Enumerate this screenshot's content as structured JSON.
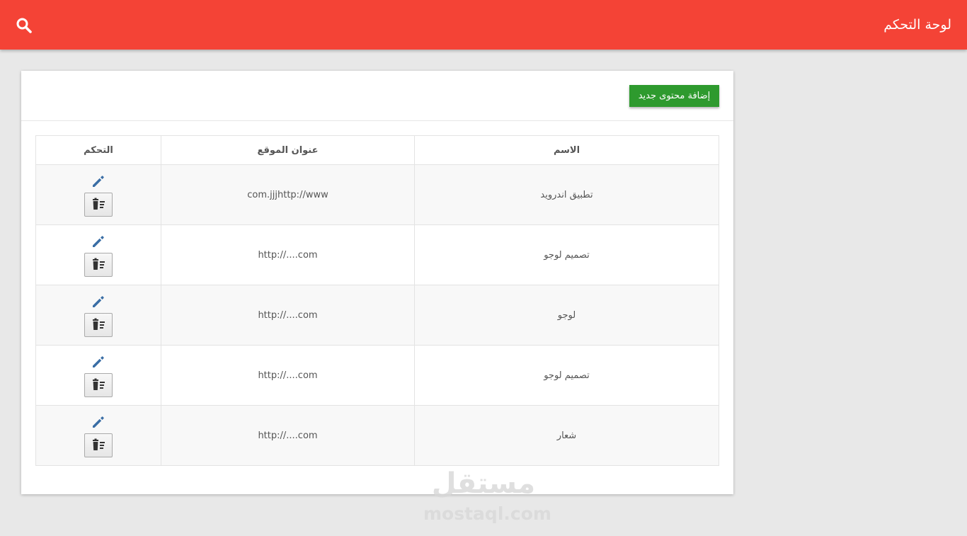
{
  "header": {
    "title": "لوحة التحكم",
    "accent_color": "#f44336",
    "search_icon": "search-icon"
  },
  "panel": {
    "add_button_label": "إضافة محتوى جديد",
    "add_button_color": "#2e9a2e"
  },
  "table": {
    "columns": {
      "name": "الاسم",
      "url": "عنوان الموقع",
      "control": "التحكم"
    },
    "rows": [
      {
        "name": "تطبيق اندرويد",
        "url": "com.jjjhttp://www"
      },
      {
        "name": "تصميم لوجو",
        "url": "http://....com"
      },
      {
        "name": "لوجو",
        "url": "http://....com"
      },
      {
        "name": "تصميم لوجو",
        "url": "http://....com"
      },
      {
        "name": "شعار",
        "url": "http://....com"
      }
    ],
    "edit_icon": "pencil-icon",
    "delete_icon": "trash-icon",
    "icon_color": "#3a6ea5"
  },
  "watermark": {
    "arabic": "مستقل",
    "latin": "mostaql.com"
  }
}
